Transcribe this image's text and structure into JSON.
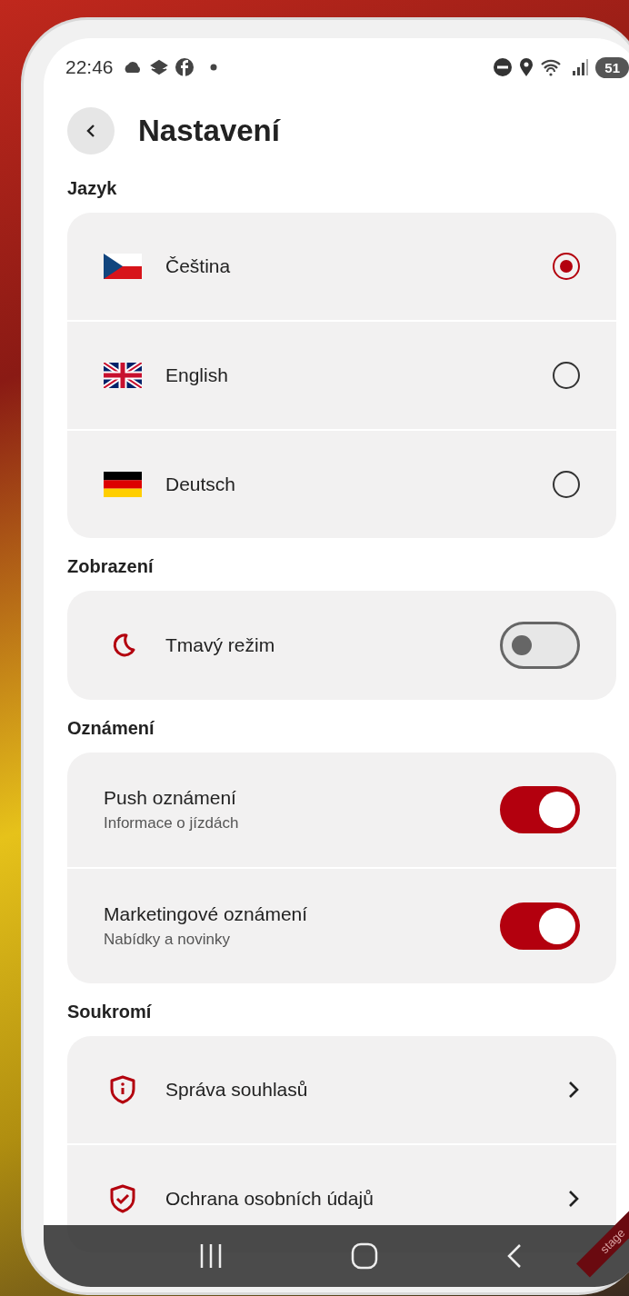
{
  "status_bar": {
    "time": "22:46",
    "battery": "51"
  },
  "header": {
    "title": "Nastavení"
  },
  "sections": [
    {
      "title": "Jazyk",
      "items": [
        {
          "kind": "radio",
          "label": "Čeština",
          "selected": true
        },
        {
          "kind": "radio",
          "label": "English",
          "selected": false
        },
        {
          "kind": "radio",
          "label": "Deutsch",
          "selected": false
        }
      ]
    },
    {
      "title": "Zobrazení",
      "items": [
        {
          "kind": "toggle",
          "label": "Tmavý režim",
          "on": false
        }
      ]
    },
    {
      "title": "Oznámení",
      "items": [
        {
          "kind": "toggle",
          "label": "Push oznámení",
          "subtitle": "Informace o jízdách",
          "on": true
        },
        {
          "kind": "toggle",
          "label": "Marketingové oznámení",
          "subtitle": "Nabídky a novinky",
          "on": true
        }
      ]
    },
    {
      "title": "Soukromí",
      "items": [
        {
          "kind": "link",
          "label": "Správa souhlasů"
        },
        {
          "kind": "link",
          "label": "Ochrana osobních údajů"
        }
      ]
    }
  ],
  "env_banner": "stage"
}
